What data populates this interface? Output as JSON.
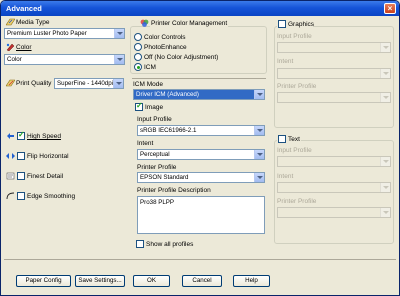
{
  "window": {
    "title": "Advanced",
    "close_symbol": "×"
  },
  "left": {
    "media_type_label": "Media Type",
    "media_type_value": "Premium Luster Photo Paper",
    "color_label": "Color",
    "color_value": "Color",
    "print_quality_label": "Print Quality",
    "print_quality_value": "SuperFine - 1440dpi",
    "high_speed_label": "High Speed",
    "flip_horizontal_label": "Flip Horizontal",
    "finest_detail_label": "Finest Detail",
    "edge_smoothing_label": "Edge Smoothing"
  },
  "middle": {
    "group_label": "Printer Color Management",
    "radio_color_controls": "Color Controls",
    "radio_photoenhance": "PhotoEnhance",
    "radio_off": "Off (No Color Adjustment)",
    "radio_icm": "ICM",
    "icm_mode_label": "ICM Mode",
    "icm_mode_value": "Driver ICM (Advanced)",
    "image_label": "Image",
    "input_profile_label": "Input Profile",
    "input_profile_value": "sRGB IEC61966-2.1",
    "intent_label": "Intent",
    "intent_value": "Perceptual",
    "printer_profile_label": "Printer Profile",
    "printer_profile_value": "EPSON Standard",
    "printer_profile_desc_label": "Printer Profile Description",
    "printer_profile_desc_value": "Pro38 PLPP",
    "show_all_profiles_label": "Show all profiles"
  },
  "right": {
    "graphics_label": "Graphics",
    "g_input_profile_label": "Input Profile",
    "g_intent_label": "Intent",
    "g_printer_profile_label": "Printer Profile",
    "text_label": "Text",
    "t_input_profile_label": "Input Profile",
    "t_intent_label": "Intent",
    "t_printer_profile_label": "Printer Profile"
  },
  "buttons": {
    "paper_config": "Paper Config",
    "save_settings": "Save Settings...",
    "ok": "OK",
    "cancel": "Cancel",
    "help": "Help"
  },
  "state": {
    "selected_color_mode": "ICM",
    "image_checked": true,
    "high_speed_checked": true,
    "flip_horizontal_checked": false,
    "finest_detail_checked": false,
    "edge_smoothing_checked": false,
    "show_all_profiles_checked": false,
    "graphics_checked": false,
    "text_checked": false
  },
  "icons": [
    "media-type-icon",
    "color-icon",
    "print-quality-icon",
    "high-speed-icon",
    "flip-horizontal-icon",
    "finest-detail-icon",
    "edge-smoothing-icon",
    "printer-color-management-icon"
  ],
  "colors": {
    "title_bar": "#0a44c4",
    "selection": "#316ac5",
    "face": "#ece9d8",
    "check": "#21a121"
  }
}
